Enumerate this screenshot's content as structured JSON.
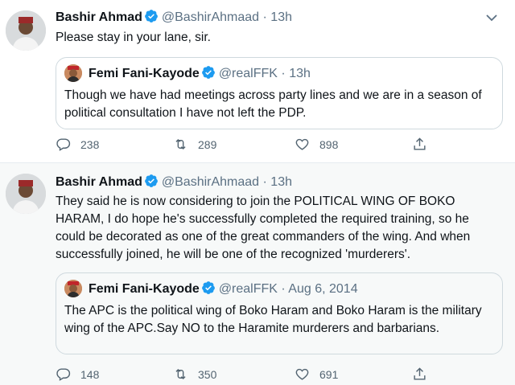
{
  "tweets": [
    {
      "author_name": "Bashir Ahmad",
      "handle": "@BashirAhmaad",
      "separator": "·",
      "time": "13h",
      "text": "Please stay in your lane, sir.",
      "quote": {
        "author_name": "Femi Fani-Kayode",
        "handle": "@realFFK",
        "separator": "·",
        "time": "13h",
        "text": "Though we have had meetings across party lines and we are in a season of political consultation I have not left the PDP."
      },
      "replies": "238",
      "retweets": "289",
      "likes": "898"
    },
    {
      "author_name": "Bashir Ahmad",
      "handle": "@BashirAhmaad",
      "separator": "·",
      "time": "13h",
      "text": "They said he is now considering to join the POLITICAL WING OF BOKO HARAM, I do hope he's successfully completed the required training, so he could be decorated as one of the great commanders of the wing. And when successfully joined, he will be one of the recognized 'murderers'.",
      "quote": {
        "author_name": "Femi Fani-Kayode",
        "handle": "@realFFK",
        "separator": "·",
        "time": "Aug 6, 2014",
        "text": "The APC is the political wing of Boko Haram and Boko Haram is the military wing of the APC.Say NO to the Haramite murderers and barbarians."
      },
      "replies": "148",
      "retweets": "350",
      "likes": "691"
    }
  ],
  "icons": {
    "verified": "verified-badge-icon",
    "more": "more-options-icon",
    "reply": "reply-icon",
    "retweet": "retweet-icon",
    "like": "heart-icon",
    "share": "share-icon"
  },
  "colors": {
    "verified_blue": "#1d9bf0",
    "muted_text": "#5b7083",
    "border": "#cfd9de"
  }
}
